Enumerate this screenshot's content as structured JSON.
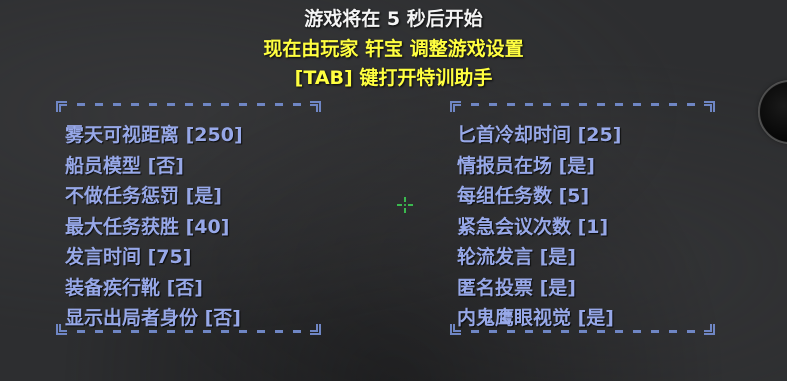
{
  "header": {
    "countdown_text": "游戏将在 5 秒后开始",
    "host_text": "现在由玩家 轩宝 调整游戏设置",
    "tab_key": "[TAB]",
    "tab_hint": " 键打开特训助手"
  },
  "left_settings": [
    {
      "label": "雾天可视距离 [250]"
    },
    {
      "label": "船员模型 [否]"
    },
    {
      "label": "不做任务惩罚 [是]"
    },
    {
      "label": "最大任务获胜 [40]"
    },
    {
      "label": "发言时间 [75]"
    },
    {
      "label": "装备疾行靴 [否]"
    },
    {
      "label": "显示出局者身份 [否]"
    }
  ],
  "right_settings": [
    {
      "label": "匕首冷却时间 [25]"
    },
    {
      "label": "情报员在场 [是]"
    },
    {
      "label": "每组任务数 [5]"
    },
    {
      "label": "紧急会议次数 [1]"
    },
    {
      "label": "轮流发言 [是]"
    },
    {
      "label": "匿名投票 [是]"
    },
    {
      "label": "内鬼鹰眼视觉 [是]"
    }
  ],
  "colors": {
    "title_white": "#f4f4f4",
    "title_yellow": "#ffff40",
    "setting_blue": "#97a8e8",
    "frame_blue": "#6f86c4",
    "crosshair_green": "#3fe85a"
  },
  "icons": {
    "crosshair": "crosshair-icon"
  }
}
